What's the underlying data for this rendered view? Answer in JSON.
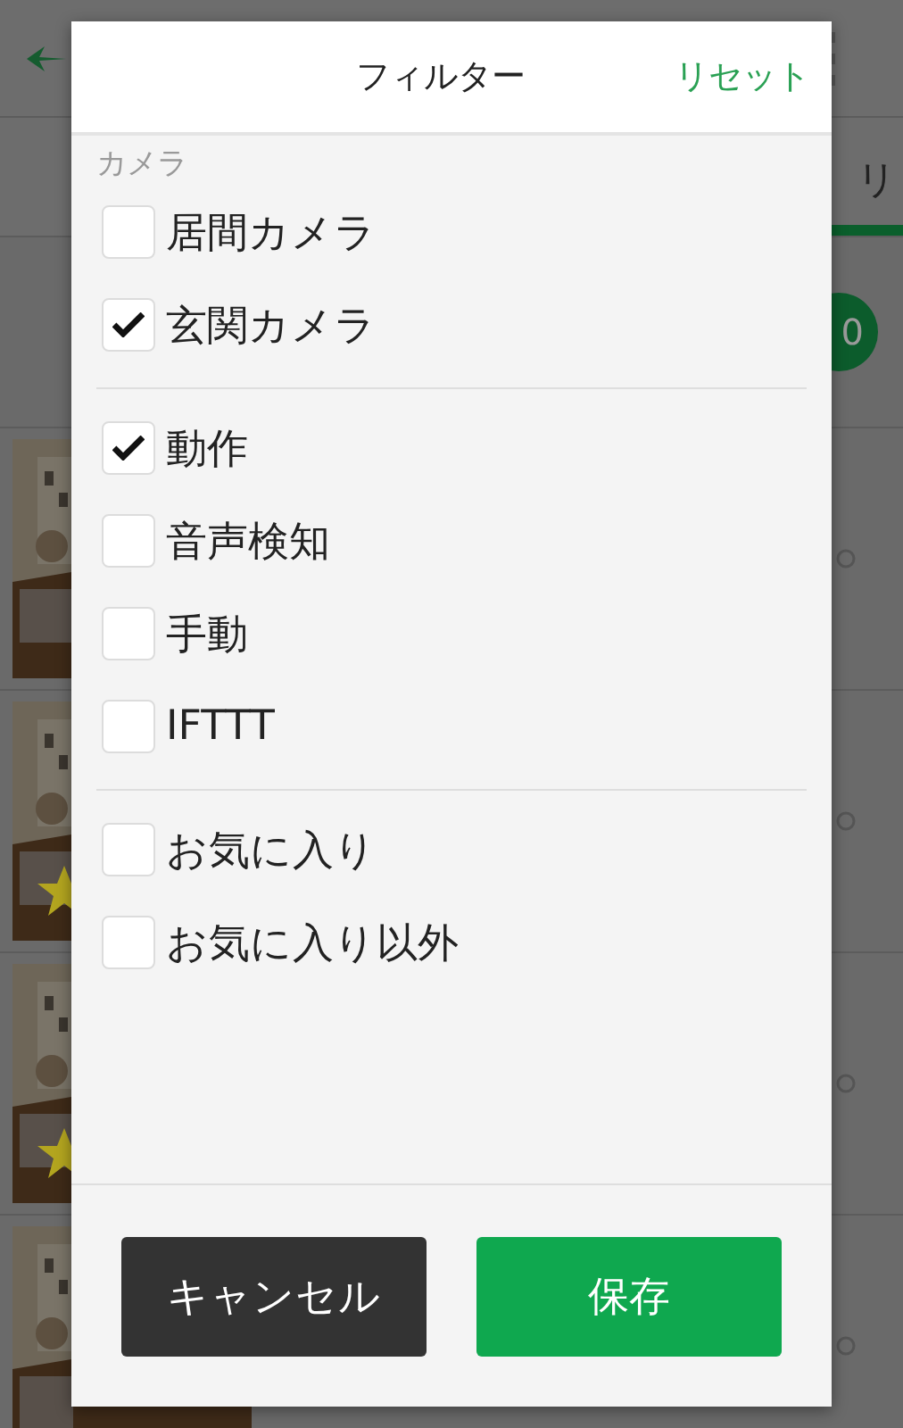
{
  "background": {
    "tab_label": "リ",
    "badge": "0",
    "rows": [
      {
        "favorite": false
      },
      {
        "favorite": true
      },
      {
        "favorite": true
      },
      {
        "favorite": false
      }
    ]
  },
  "dialog": {
    "title": "フィルター",
    "reset": "リセット",
    "groups": [
      {
        "label": "カメラ",
        "items": [
          {
            "label": "居間カメラ",
            "checked": false
          },
          {
            "label": "玄関カメラ",
            "checked": true
          }
        ]
      },
      {
        "items": [
          {
            "label": "動作",
            "checked": true
          },
          {
            "label": "音声検知",
            "checked": false
          },
          {
            "label": "手動",
            "checked": false
          },
          {
            "label": "IFTTT",
            "checked": false
          }
        ]
      },
      {
        "items": [
          {
            "label": "お気に入り",
            "checked": false
          },
          {
            "label": "お気に入り以外",
            "checked": false
          }
        ]
      }
    ],
    "buttons": [
      {
        "label": "キャンセル",
        "kind": "cancel"
      },
      {
        "label": "保存",
        "kind": "save"
      }
    ]
  }
}
